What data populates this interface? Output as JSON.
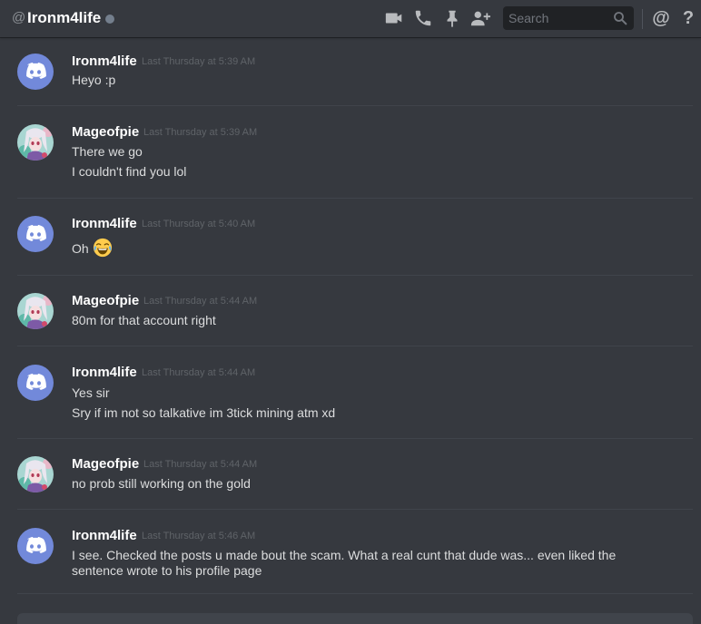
{
  "header": {
    "at_symbol": "@",
    "channel_name": "Ironm4life",
    "search_placeholder": "Search",
    "mention_label": "@",
    "help_label": "?"
  },
  "colors": {
    "background": "#36393f",
    "blurple": "#7289da",
    "username": "#ffffff",
    "message_text": "#dcddde",
    "timestamp": "#5f6368"
  },
  "icons": [
    "video-call-icon",
    "voice-call-icon",
    "pin-icon",
    "add-friend-icon",
    "search-icon",
    "mention-icon",
    "help-icon",
    "discord-avatar-icon",
    "anime-avatar-icon",
    "laughing-emoji-icon"
  ],
  "messages": [
    {
      "username": "Ironm4life",
      "timestamp": "Last Thursday at 5:39 AM",
      "lines": [
        "Heyo :p"
      ]
    },
    {
      "username": "Mageofpie",
      "timestamp": "Last Thursday at 5:39 AM",
      "lines": [
        "There we go",
        "I couldn't find you lol"
      ]
    },
    {
      "username": "Ironm4life",
      "timestamp": "Last Thursday at 5:40 AM",
      "lines": [
        "Oh"
      ]
    },
    {
      "username": "Mageofpie",
      "timestamp": "Last Thursday at 5:44 AM",
      "lines": [
        "80m for that account right"
      ]
    },
    {
      "username": "Ironm4life",
      "timestamp": "Last Thursday at 5:44 AM",
      "lines": [
        "Yes sir",
        "Sry if im not so talkative im 3tick mining atm xd"
      ]
    },
    {
      "username": "Mageofpie",
      "timestamp": "Last Thursday at 5:44 AM",
      "lines": [
        "no prob still working on the gold"
      ]
    },
    {
      "username": "Ironm4life",
      "timestamp": "Last Thursday at 5:46 AM",
      "lines": [
        "I see. Checked the posts u made bout the scam. What a real cunt that dude was... even liked the",
        "sentence wrote to his profile page"
      ]
    }
  ]
}
